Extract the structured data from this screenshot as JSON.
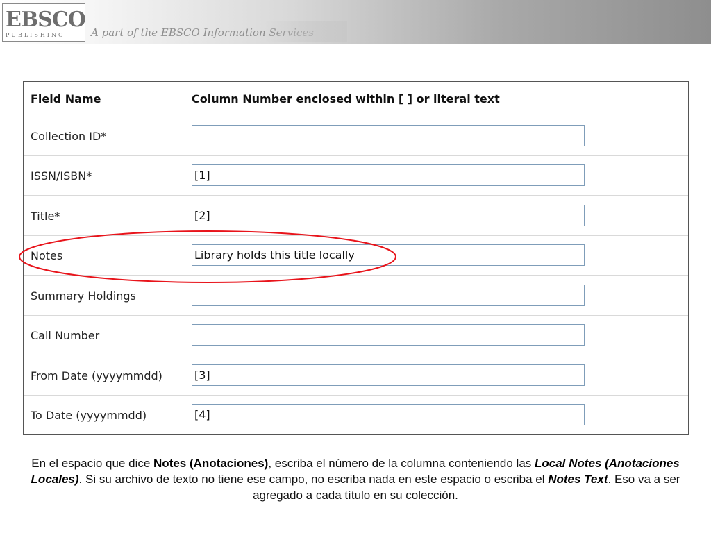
{
  "banner": {
    "logo_main": "EBSCO",
    "logo_sub": "PUBLISHING",
    "tagline": "A part of the EBSCO Information Services"
  },
  "table": {
    "header": {
      "field_name": "Field Name",
      "column": "Column Number enclosed within [ ] or literal text"
    },
    "rows": [
      {
        "label": "Collection ID*",
        "value": ""
      },
      {
        "label": "ISSN/ISBN*",
        "value": "[1]"
      },
      {
        "label": "Title*",
        "value": "[2]"
      },
      {
        "label": "Notes",
        "value": "Library holds this title locally"
      },
      {
        "label": "Summary Holdings",
        "value": ""
      },
      {
        "label": "Call Number",
        "value": ""
      },
      {
        "label": "From Date (yyyymmdd)",
        "value": "[3]"
      },
      {
        "label": "To Date (yyyymmdd)",
        "value": "[4]"
      }
    ]
  },
  "highlight_color": "#e8141b",
  "caption": {
    "part1": "En el espacio que dice ",
    "bold1": "Notes (Anotaciones)",
    "part2": ", escriba el número de la columna conteniendo las  ",
    "bold_italic1": "Local Notes (Anotaciones Locales)",
    "part3": ". Si su archivo de texto no tiene ese campo, no escriba nada en este espacio o escriba el ",
    "bold_italic2": "Notes Text",
    "part4": ". Eso va a ser agregado a cada título en su colección."
  }
}
